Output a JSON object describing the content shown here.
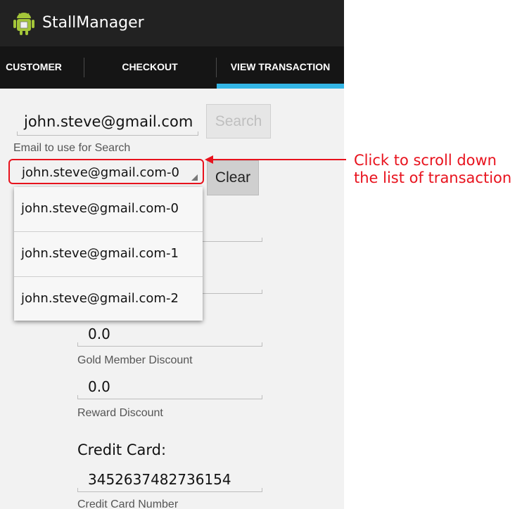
{
  "app": {
    "title": "StallManager",
    "icon": "android-icon"
  },
  "tabs": [
    {
      "label": "CUSTOMER"
    },
    {
      "label": "CHECKOUT"
    },
    {
      "label": "VIEW TRANSACTION",
      "selected": true
    }
  ],
  "search": {
    "email_value": "john.steve@gmail.com",
    "email_label": "Email to use for Search",
    "search_button": "Search",
    "clear_button": "Clear"
  },
  "spinner": {
    "selected": "john.steve@gmail.com-0",
    "options": [
      "john.steve@gmail.com-0",
      "john.steve@gmail.com-1",
      "john.steve@gmail.com-2"
    ]
  },
  "fields": {
    "gold_value": "0.0",
    "gold_label": "Gold Member Discount",
    "reward_value": "0.0",
    "reward_label": "Reward Discount",
    "credit_card_title": "Credit Card:",
    "card_number_value": "3452637482736154",
    "card_number_label": "Credit Card Number"
  },
  "annotation": {
    "line1": "Click to scroll down",
    "line2": "the list of transaction",
    "color": "#e8121d"
  },
  "colors": {
    "accent": "#33b5e5",
    "actionbar": "#222222",
    "tabbar": "#151515"
  }
}
